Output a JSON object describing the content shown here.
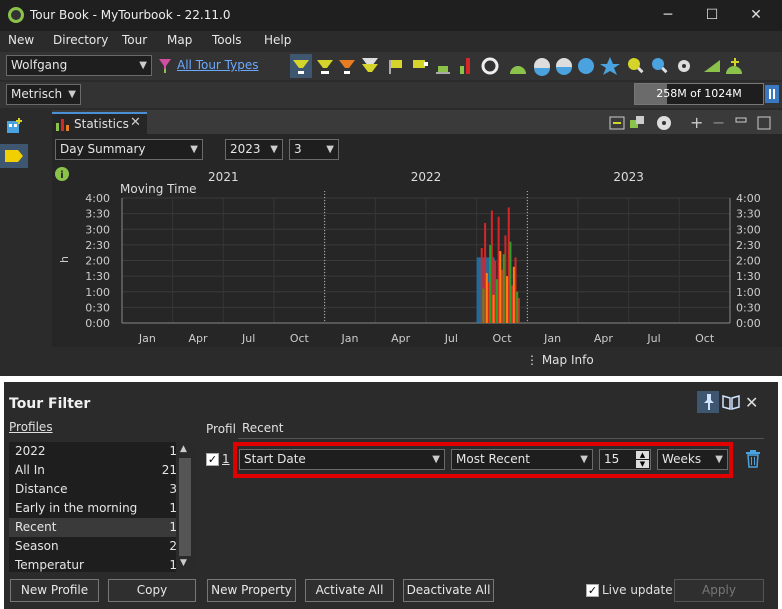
{
  "window": {
    "title": "Tour Book - MyTourbook - 22.11.0",
    "controls": [
      "─",
      "☐",
      "✕"
    ]
  },
  "menu": [
    "New",
    "Directory",
    "Tour",
    "Map",
    "Tools",
    "Help"
  ],
  "toolbar": {
    "person": "Wolfgang",
    "tour_types_link": "All Tour Types",
    "measurement": "Metrisch",
    "memory": "258M of 1024M",
    "memory_fraction": 0.25
  },
  "statistics": {
    "tab_label": "Statistics",
    "summary_select": "Day Summary",
    "year_select": "2023",
    "years_count_select": "3",
    "map_info": "Map Info"
  },
  "chart_data": {
    "type": "bar",
    "title": "Moving Time",
    "ylabel": "h",
    "years": [
      "2021",
      "2022",
      "2023"
    ],
    "x_ticks": [
      "Jan",
      "Apr",
      "Jul",
      "Oct",
      "Jan",
      "Apr",
      "Jul",
      "Oct",
      "Jan",
      "Apr",
      "Jul",
      "Oct"
    ],
    "y_ticks": [
      "0:00",
      "0:30",
      "1:00",
      "1:30",
      "2:00",
      "2:30",
      "3:00",
      "3:30",
      "4:00"
    ],
    "ylim": [
      0,
      4
    ],
    "grid": true,
    "series": [
      {
        "color": "#1f77b4",
        "x_month_index": [
          21.0
        ],
        "values": [
          2.1
        ]
      },
      {
        "color": "#d62728",
        "x_month_index": [
          21.3,
          21.5,
          21.7,
          21.9,
          22.1,
          22.3,
          22.5,
          22.7,
          22.9,
          23.1,
          23.3,
          23.5
        ],
        "values": [
          2.4,
          3.2,
          1.3,
          3.6,
          2.0,
          3.4,
          1.7,
          2.8,
          3.7,
          1.2,
          2.1,
          0.8
        ]
      },
      {
        "color": "#2ca02c",
        "x_month_index": [
          21.4,
          21.8,
          22.2,
          22.6,
          23.0,
          23.4
        ],
        "values": [
          1.1,
          2.5,
          1.4,
          2.2,
          2.6,
          1.0
        ]
      },
      {
        "color": "#ff7f0e",
        "x_month_index": [
          21.6,
          22.0,
          22.4,
          22.8,
          23.2
        ],
        "values": [
          1.6,
          0.9,
          2.3,
          1.5,
          1.8
        ]
      }
    ]
  },
  "tour_filter": {
    "title": "Tour Filter",
    "profiles_label": "Profiles",
    "profiles": [
      {
        "name": "2022",
        "count": "1"
      },
      {
        "name": "All In",
        "count": "21"
      },
      {
        "name": "Distance",
        "count": "3"
      },
      {
        "name": "Early in the morning",
        "count": "1"
      },
      {
        "name": "Recent",
        "count": "1"
      },
      {
        "name": "Season",
        "count": "2"
      },
      {
        "name": "Temperatur",
        "count": "1"
      }
    ],
    "profile_label": "Profil",
    "profile_name": "Recent",
    "filter_index": "1",
    "filter_field": "Start Date",
    "filter_operator": "Most Recent",
    "filter_value": "15",
    "filter_unit": "Weeks",
    "buttons": {
      "new_profile": "New Profile",
      "copy": "Copy",
      "new_property": "New Property",
      "activate_all": "Activate All",
      "deactivate_all": "Deactivate All",
      "live_update": "Live update",
      "apply": "Apply"
    }
  }
}
